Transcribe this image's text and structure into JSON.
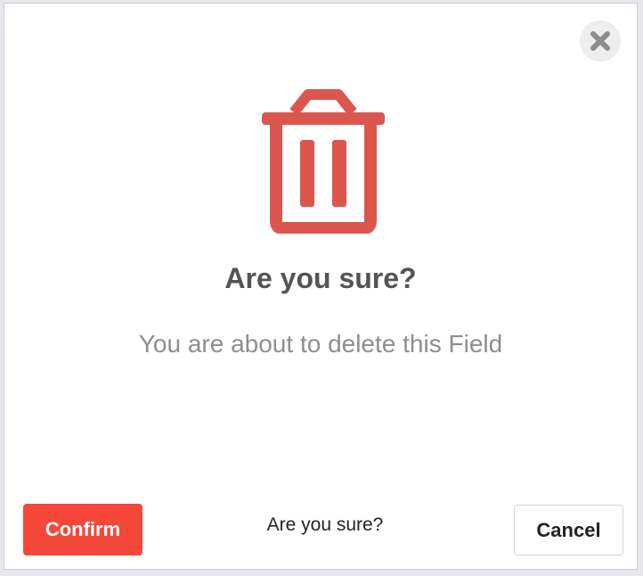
{
  "dialog": {
    "close_icon": "close-icon",
    "main_icon": "trash-icon",
    "title": "Are you sure?",
    "message": "You are about to delete this Field",
    "footer_text": "Are you sure?",
    "confirm_label": "Confirm",
    "cancel_label": "Cancel"
  },
  "colors": {
    "accent": "#f4473a",
    "icon": "#dc5650",
    "close_icon": "#8c8c8c"
  }
}
